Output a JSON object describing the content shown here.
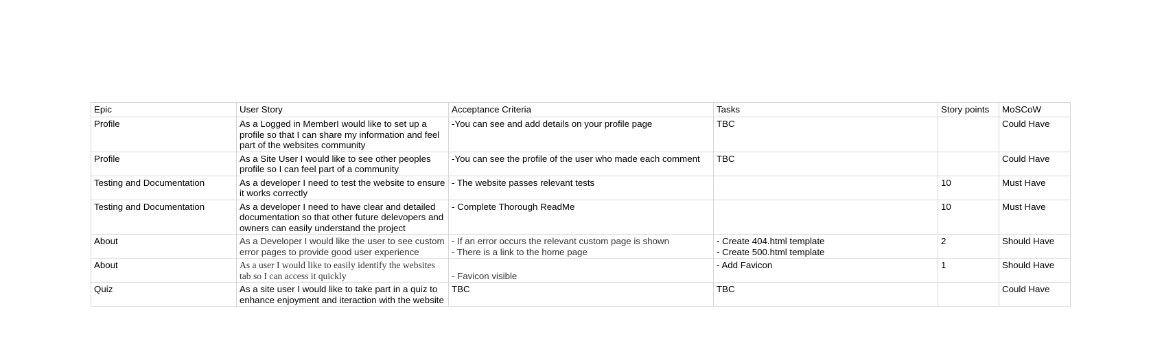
{
  "table": {
    "headers": [
      "Epic",
      "User Story",
      "Acceptance Criteria",
      "Tasks",
      "Story points",
      "MoSCoW"
    ],
    "rows": [
      {
        "epic": "Profile",
        "user_story": "As a Logged in MemberI would like to set up a profile so that I can share my information and feel part of the websites community",
        "acceptance_criteria": "-You can see and add details on your profile page",
        "tasks": "TBC",
        "story_points": "",
        "moscow": "Could Have"
      },
      {
        "epic": "Profile",
        "user_story": "As a Site User I would like to see other peoples profile so I can feel part of a community",
        "acceptance_criteria": "-You can see the profile of the user who made each comment",
        "tasks": "TBC",
        "story_points": "",
        "moscow": "Could Have"
      },
      {
        "epic": "Testing and Documentation",
        "user_story": "As a developer I need to test the website to ensure it works correctly",
        "acceptance_criteria": "- The website passes relevant tests",
        "tasks": "",
        "story_points": "10",
        "moscow": "Must Have"
      },
      {
        "epic": "Testing and Documentation",
        "user_story": "As a developer I need to have clear and detailed documentation so that other future delevopers and owners can easily understand the project",
        "acceptance_criteria": "- Complete Thorough ReadMe",
        "tasks": "",
        "story_points": "10",
        "moscow": "Must Have"
      },
      {
        "epic": "About",
        "user_story": "As a Developer I would like the user to see custom error pages to provide good user experience",
        "acceptance_criteria": "- If an error occurs the relevant custom page is shown\n- There is a link to the home page",
        "tasks": "- Create 404.html template\n- Create 500.html template",
        "story_points": "2",
        "moscow": "Should Have"
      },
      {
        "epic": "About",
        "user_story": "As a user I would like to easily identify the websites tab so I can access it quickly",
        "acceptance_criteria": "- Favicon visible",
        "tasks": "- Add Favicon",
        "story_points": "1",
        "moscow": "Should Have"
      },
      {
        "epic": "Quiz",
        "user_story": "As a site user I would like to take part in a quiz to enhance enjoyment and iteraction with the website",
        "acceptance_criteria": "TBC",
        "tasks": "TBC",
        "story_points": "",
        "moscow": "Could Have"
      }
    ]
  }
}
